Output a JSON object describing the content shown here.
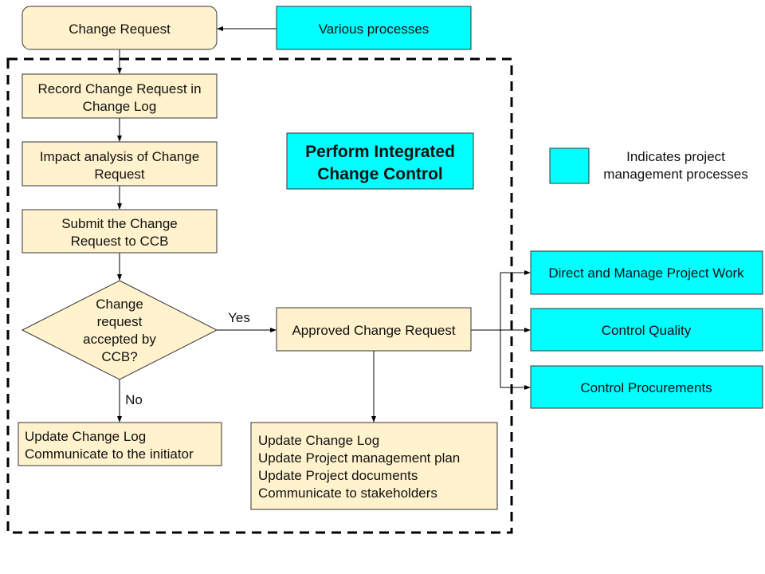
{
  "title": "Perform Integrated Change Control",
  "colors": {
    "step_fill": "#fff2cc",
    "process_fill": "#00ffff"
  },
  "nodes": {
    "change_request": "Change Request",
    "various_processes": "Various processes",
    "record": [
      "Record Change Request in",
      "Change Log"
    ],
    "impact": [
      "Impact analysis of Change",
      "Request"
    ],
    "submit": [
      "Submit the Change",
      "Request to CCB"
    ],
    "decision": [
      "Change",
      "request",
      "accepted by",
      "CCB?"
    ],
    "approved": "Approved Change Request",
    "update_left": [
      "Update Change Log",
      "Communicate to the initiator"
    ],
    "update_right": [
      "Update Change Log",
      "Update Project management plan",
      "Update Project documents",
      "Communicate to stakeholders"
    ],
    "direct_manage": "Direct and Manage Project Work",
    "control_quality": "Control Quality",
    "control_procurements": "Control Procurements"
  },
  "edges": {
    "yes": "Yes",
    "no": "No"
  },
  "legend": {
    "text": [
      "Indicates project",
      "management processes"
    ]
  }
}
